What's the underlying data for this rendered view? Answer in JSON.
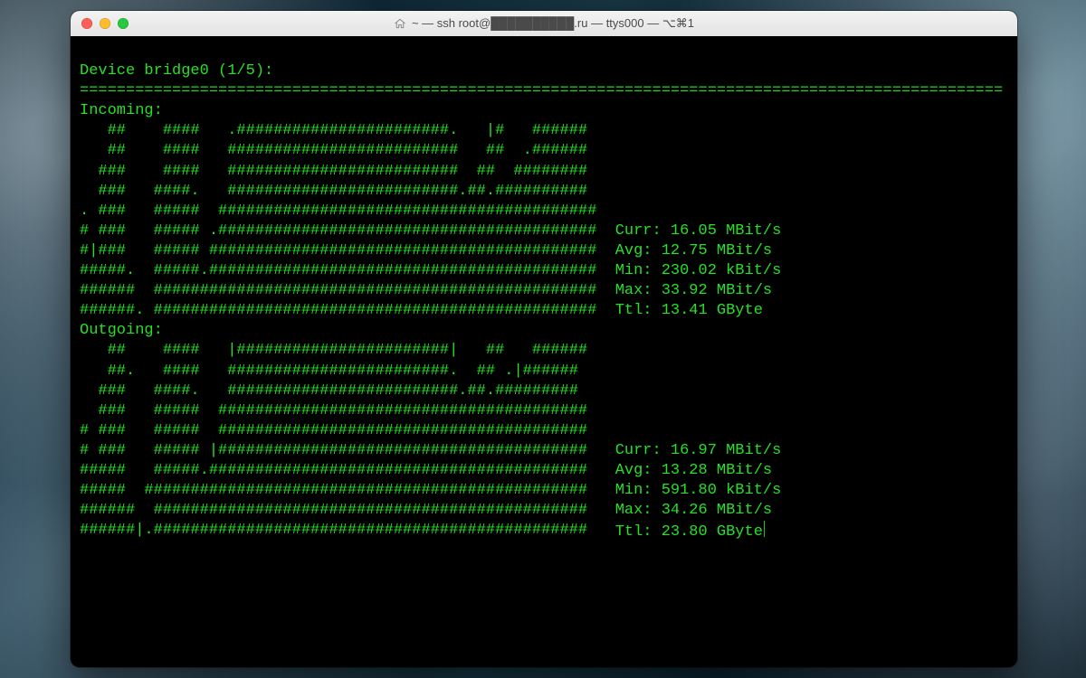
{
  "window": {
    "title_prefix_icon": "home",
    "title": "~ — ssh root@██████████.ru — ttys000 — ⌥⌘1"
  },
  "term": {
    "device_line": "Device bridge0 (1/5):",
    "separator_char": "=",
    "separator_cols": 100,
    "incoming_label": "Incoming:",
    "outgoing_label": "Outgoing:",
    "incoming_graph": [
      "   ##    ####   .#######################.   |#   ######",
      "   ##    ####   #########################   ##  .######",
      "  ###    ####   #########################  ##  ########",
      "  ###   ####.   #########################.##.##########",
      ". ###   #####  #########################################",
      "# ###   ##### .#########################################",
      "#|###   ##### ##########################################",
      "#####.  #####.##########################################",
      "######  ################################################",
      "######. ################################################"
    ],
    "outgoing_graph": [
      "   ##    ####   |#######################|   ##   ######",
      "   ##.   ####   ########################.  ## .|######",
      "  ###   ####.   #########################.##.#########",
      "  ###   #####  ########################################",
      "# ###   #####  ########################################",
      "# ###   ##### |########################################",
      "#####   #####.#########################################",
      "#####  ################################################",
      "######  ###############################################",
      "######|.###############################################"
    ],
    "graph_col_width": 56,
    "incoming_stats": {
      "curr": "16.05 MBit/s",
      "avg": "12.75 MBit/s",
      "min": "230.02 kBit/s",
      "max": "33.92 MBit/s",
      "ttl": "13.41 GByte"
    },
    "outgoing_stats": {
      "curr": "16.97 MBit/s",
      "avg": "13.28 MBit/s",
      "min": "591.80 kBit/s",
      "max": "34.26 MBit/s",
      "ttl": "23.80 GByte"
    },
    "stat_labels": {
      "curr": "Curr:",
      "avg": "Avg:",
      "min": "Min:",
      "max": "Max:",
      "ttl": "Ttl:"
    }
  },
  "colors": {
    "term_fg": "#26e026",
    "term_bg": "#000000"
  }
}
